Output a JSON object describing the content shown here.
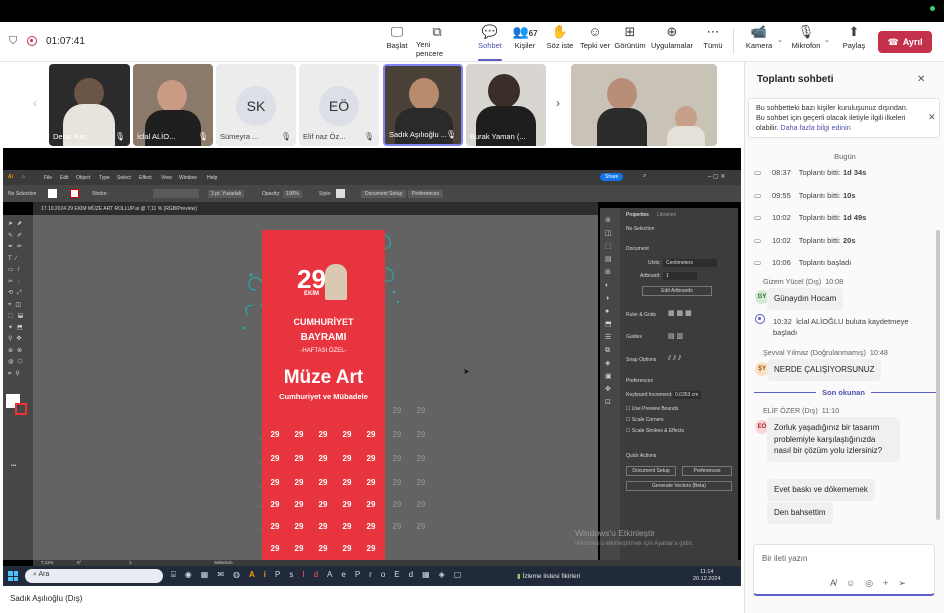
{
  "meeting": {
    "timer": "01:07:41",
    "presenter_label": "Sadık Aşılıoğlu (Dış)"
  },
  "toolbar": {
    "items": [
      {
        "label": "Başlat"
      },
      {
        "label": "Yeni pencere"
      },
      {
        "label": "Sohbet"
      },
      {
        "label": "Kişiler",
        "count": "67"
      },
      {
        "label": "Söz iste"
      },
      {
        "label": "Tepki ver"
      },
      {
        "label": "Görünüm"
      },
      {
        "label": "Uygulamalar"
      },
      {
        "label": "Tümü"
      },
      {
        "label": "Kamera"
      },
      {
        "label": "Mikrofon"
      },
      {
        "label": "Paylaş"
      }
    ],
    "leave_label": "Ayrıl"
  },
  "participants": [
    {
      "name": "Deniz Kar...",
      "type": "video",
      "color": "#2b2b2b"
    },
    {
      "name": "İclal ALİO...",
      "type": "video",
      "color": "#6f5b4d"
    },
    {
      "name": "Sümeyra ...",
      "type": "initials",
      "initials": "SK"
    },
    {
      "name": "Elif naz Öz...",
      "type": "initials",
      "initials": "EÖ"
    },
    {
      "name": "Sadık Aşılıoğlu ...",
      "type": "video",
      "color": "#4a4138"
    },
    {
      "name": "Burak Yaman (...",
      "type": "video",
      "color": "#3e3a36"
    },
    {
      "name": "",
      "type": "video",
      "color": "#8a7a6a"
    }
  ],
  "illustrator": {
    "menu": [
      "File",
      "Edit",
      "Object",
      "Type",
      "Select",
      "Effect",
      "View",
      "Window",
      "Help"
    ],
    "share_label": "Share",
    "doc_tab": "17.10.2024 29 EKİM MÜZE ART ROLLUP.ai @ 7,11 % (RGB/Preview)",
    "control": {
      "no_selection": "No Selection",
      "stroke": "Stroke:",
      "brush": "3 pt. Yuvarlak",
      "opacity_label": "Opacity:",
      "opacity": "100%",
      "style": "Style:",
      "doc_setup": "Document Setup",
      "prefs": "Preferences"
    },
    "panel": {
      "tabs": [
        "Properties",
        "Libraries"
      ],
      "no_selection": "No Selection",
      "document": "Document",
      "units_label": "Units:",
      "units": "Centimeters",
      "artboard_label": "Artboard:",
      "artboard": "1",
      "edit_artboards": "Edit Artboards",
      "ruler_grids": "Ruler & Grids",
      "guides": "Guides",
      "snap_options": "Snap Options",
      "preferences": "Preferences",
      "keyboard_increment_label": "Keyboard Increment:",
      "keyboard_increment": "0,0353 cm",
      "use_preview_bounds": "Use Preview Bounds",
      "scale_corners": "Scale Corners",
      "scale_strokes": "Scale Strokes & Effects",
      "quick_actions": "Quick Actions",
      "btn_doc_setup": "Document Setup",
      "btn_prefs": "Preferences",
      "btn_generate": "Generate Vectors (Beta)"
    },
    "status": {
      "zoom": "7,11%",
      "angle": "0°",
      "page": "1",
      "mode": "Selection"
    },
    "poster": {
      "num": "29",
      "ekim": "EKİM",
      "line1": "CUMHURİYET",
      "line2": "BAYRAMI",
      "line3": "-HAFTASI ÖZEL-",
      "title": "Müze Art",
      "subtitle": "Cumhuriyet ve Mübadele"
    },
    "watermark_title": "Windows'u Etkinleştir",
    "watermark_sub": "Windows'u etkinleştirmek için Ayarlar'a gidin."
  },
  "taskbar": {
    "search": "Ara",
    "notification": "İzleme listesi fikirleri",
    "time": "11:14",
    "date": "20.12.2024"
  },
  "chat": {
    "title": "Toplantı sohbeti",
    "notice_text": "Bu sohbetteki bazı kişiler kuruluşunuz dışından. Bu sohbet için geçerli olacak iletiyle ilgili ilkeleri olabilir.",
    "notice_link": "Daha fazla bilgi edinin",
    "day": "Bugün",
    "events": [
      {
        "time": "08:37",
        "text": "Toplantı bitti:",
        "duration": "1d 34s"
      },
      {
        "time": "09:55",
        "text": "Toplantı bitti:",
        "duration": "10s"
      },
      {
        "time": "10:02",
        "text": "Toplantı bitti:",
        "duration": "1d 49s"
      },
      {
        "time": "10:02",
        "text": "Toplantı bitti:",
        "duration": "20s"
      },
      {
        "time": "10:06",
        "text": "Toplantı başladı",
        "duration": ""
      }
    ],
    "msg1": {
      "sender": "Gizem Yücel (Dış)",
      "time": "10:08",
      "initials": "GY",
      "text": "Günaydın Hocam"
    },
    "recording": {
      "time": "10:32",
      "text": "İclal ALİOĞLU buluta kaydetmeye başladı"
    },
    "msg2": {
      "sender": "Şevval Yılmaz (Doğrulanmamış)",
      "time": "10:48",
      "initials": "ŞY",
      "text": "NERDE ÇALIŞIYORSUNUZ"
    },
    "unread_label": "Son okunan",
    "msg3": {
      "sender": "ELİF ÖZER (Dış)",
      "time": "11:10",
      "initials": "EÖ",
      "texts": [
        "Zorluk yaşadığınız bir tasarım problemiyle karşılaştığınızda nasıl bir çözüm yolu izlersiniz?",
        "Evet baskı ve dökememek",
        "Den bahsettim"
      ]
    },
    "compose_placeholder": "Bir ileti yazın"
  }
}
